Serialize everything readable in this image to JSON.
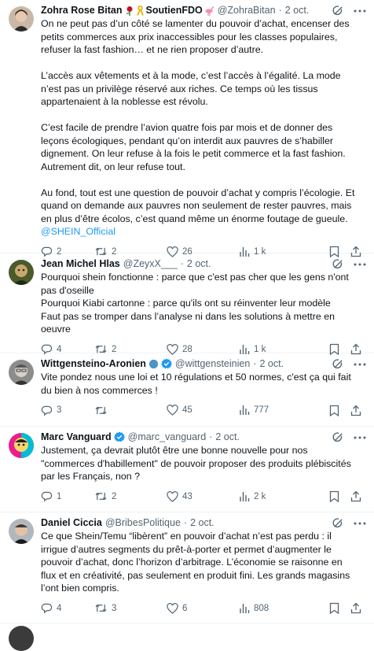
{
  "tweets": [
    {
      "name": "Zohra Rose Bitan",
      "extra_text": "SoutienFDO",
      "handle": "@ZohraBitan",
      "date": "2 oct.",
      "paragraphs": [
        "On ne peut pas d’un côté se lamenter du pouvoir d’achat, encenser des petits commerces aux prix inaccessibles pour les classes populaires, refuser la fast fashion… et ne rien proposer d’autre.",
        "",
        "L’accès aux vêtements et à la mode, c’est l’accès à l’égalité. La mode n’est pas un privilège réservé aux riches. Ce temps où les tissus appartenaient à la noblesse est révolu.",
        "",
        "C’est facile de prendre l’avion quatre fois par mois et de donner des leçons écologiques, pendant qu’on interdit aux pauvres de s’habiller dignement. On leur refuse à la fois le petit commerce et la fast fashion. Autrement dit, on leur refuse tout.",
        "",
        "Au fond, tout est une question de pouvoir d’achat y compris l’écologie. Et quand on demande aux pauvres non seulement de rester pauvres, mais en plus d’être écolos, c’est quand même un énorme foutage de gueule."
      ],
      "mention": "@SHEIN_Official",
      "replies": "2",
      "retweets": "2",
      "likes": "26",
      "views": "1 k"
    },
    {
      "name": "Jean Michel Hlas",
      "handle": "@ZeyxX___",
      "date": "2 oct.",
      "paragraphs": [
        "Pourquoi shein fonctionne : parce que c'est pas cher que les gens n'ont pas d'oseille",
        "Pourquoi Kiabi cartonne : parce qu'ils ont su réinventer leur modèle",
        "Faut pas se tromper dans l’analyse ni dans les solutions à mettre en oeuvre"
      ],
      "replies": "4",
      "retweets": "2",
      "likes": "28",
      "views": "1 k"
    },
    {
      "name": "Wittgensteino-Aronien",
      "handle": "@wittgensteinien",
      "date": "2 oct.",
      "paragraphs": [
        "Vite pondez nous une loi et 10 régulations et 50 normes, c'est ça qui fait du bien à nos commerces !"
      ],
      "replies": "3",
      "retweets": "",
      "likes": "45",
      "views": "777"
    },
    {
      "name": "Marc Vanguard",
      "handle": "@marc_vanguard",
      "date": "2 oct.",
      "paragraphs": [
        "Justement, ça devrait plutôt être une bonne nouvelle pour nos \"commerces d'habillement\" de pouvoir proposer des produits plébiscités par les Français, non ?"
      ],
      "replies": "1",
      "retweets": "2",
      "likes": "43",
      "views": "2 k"
    },
    {
      "name": "Daniel Ciccia",
      "handle": "@BribesPolitique",
      "date": "2 oct.",
      "paragraphs": [
        "Ce que Shein/Temu “libèrent” en pouvoir d’achat n’est pas perdu : il irrigue d’autres segments du prêt-à-porter et permet d’augmenter le pouvoir d’achat, donc l’horizon d’arbitrage. L’économie se raisonne en flux et en créativité, pas seulement en produit fini. Les grands magasins l’ont bien compris."
      ],
      "replies": "4",
      "retweets": "3",
      "likes": "6",
      "views": "808"
    }
  ],
  "colors": {
    "text": "#0f1419",
    "secondary": "#536471",
    "link": "#1d9bf0",
    "verified": "#1d9bf0",
    "divider": "#eff3f4"
  },
  "icons": [
    "reply-icon",
    "retweet-icon",
    "like-icon",
    "views-icon",
    "bookmark-icon",
    "share-icon",
    "grok-icon",
    "more-icon",
    "verified-badge-icon",
    "rose-icon",
    "ribbon-icon",
    "flamingo-icon",
    "globe-icon"
  ]
}
